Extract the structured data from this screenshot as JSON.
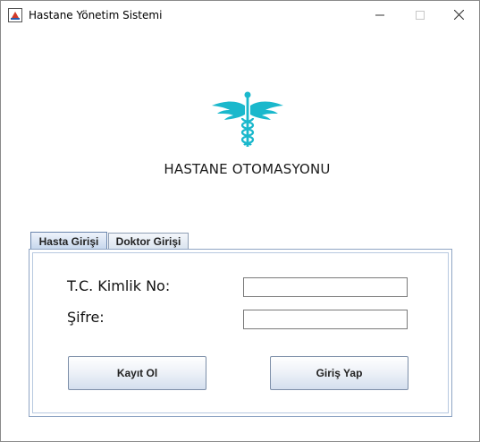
{
  "window": {
    "title": "Hastane Yönetim Sistemi",
    "icon": "java-app-icon"
  },
  "controls": {
    "minimize": "minimize-icon",
    "maximize": "maximize-icon",
    "close": "close-icon"
  },
  "logo": {
    "icon": "caduceus-icon",
    "color": "#1ab8cc"
  },
  "heading": "HASTANE OTOMASYONU",
  "tabs": [
    {
      "label": "Hasta Girişi",
      "selected": true
    },
    {
      "label": "Doktor Girişi",
      "selected": false
    }
  ],
  "form": {
    "tc_label": "T.C. Kimlik No:",
    "tc_value": "",
    "password_label": "Şifre:",
    "password_value": ""
  },
  "buttons": {
    "register": "Kayıt Ol",
    "login": "Giriş Yap"
  }
}
